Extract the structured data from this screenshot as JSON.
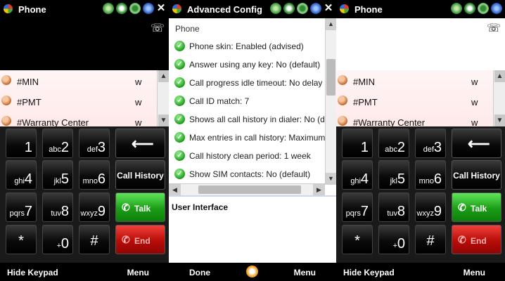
{
  "phone_left": {
    "title": "Phone",
    "contacts": [
      {
        "name": "#MIN",
        "type": "w"
      },
      {
        "name": "#PMT",
        "type": "w"
      },
      {
        "name": "#Warranty Center",
        "type": "w"
      }
    ],
    "keys": [
      {
        "sub": "",
        "num": "1"
      },
      {
        "sub": "abc",
        "num": "2"
      },
      {
        "sub": "def",
        "num": "3"
      },
      {
        "sub": "ghi",
        "num": "4"
      },
      {
        "sub": "jkl",
        "num": "5"
      },
      {
        "sub": "mno",
        "num": "6"
      },
      {
        "sub": "pqrs",
        "num": "7"
      },
      {
        "sub": "tuv",
        "num": "8"
      },
      {
        "sub": "wxyz",
        "num": "9"
      },
      {
        "sub": "",
        "num": "*"
      },
      {
        "sub": "+",
        "num": "0"
      },
      {
        "sub": "",
        "num": "#"
      }
    ],
    "call_history_label": "Call History",
    "talk_label": "Talk",
    "end_label": "End",
    "softkey_left": "Hide Keypad",
    "softkey_right": "Menu"
  },
  "config": {
    "title": "Advanced Config",
    "section_header": "Phone",
    "items": [
      "Phone skin: Enabled (advised)",
      "Answer using any key: No (default)",
      "Call progress idle timeout: No delay",
      "Call ID match: 7",
      "Shows all call history in dialer: No (d",
      "Max entries in call history: Maximum",
      "Call history clean period: 1 week",
      "Show SIM contacts: No (default)"
    ],
    "ui_section": "User Interface",
    "softkey_left": "Done",
    "softkey_right": "Menu"
  },
  "phone_right": {
    "title": "Phone",
    "contacts": [
      {
        "name": "#MIN",
        "type": "w"
      },
      {
        "name": "#PMT",
        "type": "w"
      },
      {
        "name": "#Warranty Center",
        "type": "w"
      }
    ],
    "call_history_label": "Call History",
    "talk_label": "Talk",
    "end_label": "End",
    "softkey_left": "Hide Keypad",
    "softkey_right": "Menu"
  },
  "icons": {
    "start": "windows-flag-icon",
    "tray": [
      "sync-icon",
      "battery-icon",
      "record-icon",
      "signal-icon",
      "close-icon"
    ],
    "phone_status": "phone-status-icon",
    "contact": "contact-avatar-icon",
    "check": "check-icon",
    "backspace": "backspace-arrow-icon",
    "handset": "handset-icon",
    "center_soft": "input-panel-icon"
  },
  "colors": {
    "talk": "#1b9d16",
    "end": "#b80c08",
    "check": "#1c9a18"
  }
}
